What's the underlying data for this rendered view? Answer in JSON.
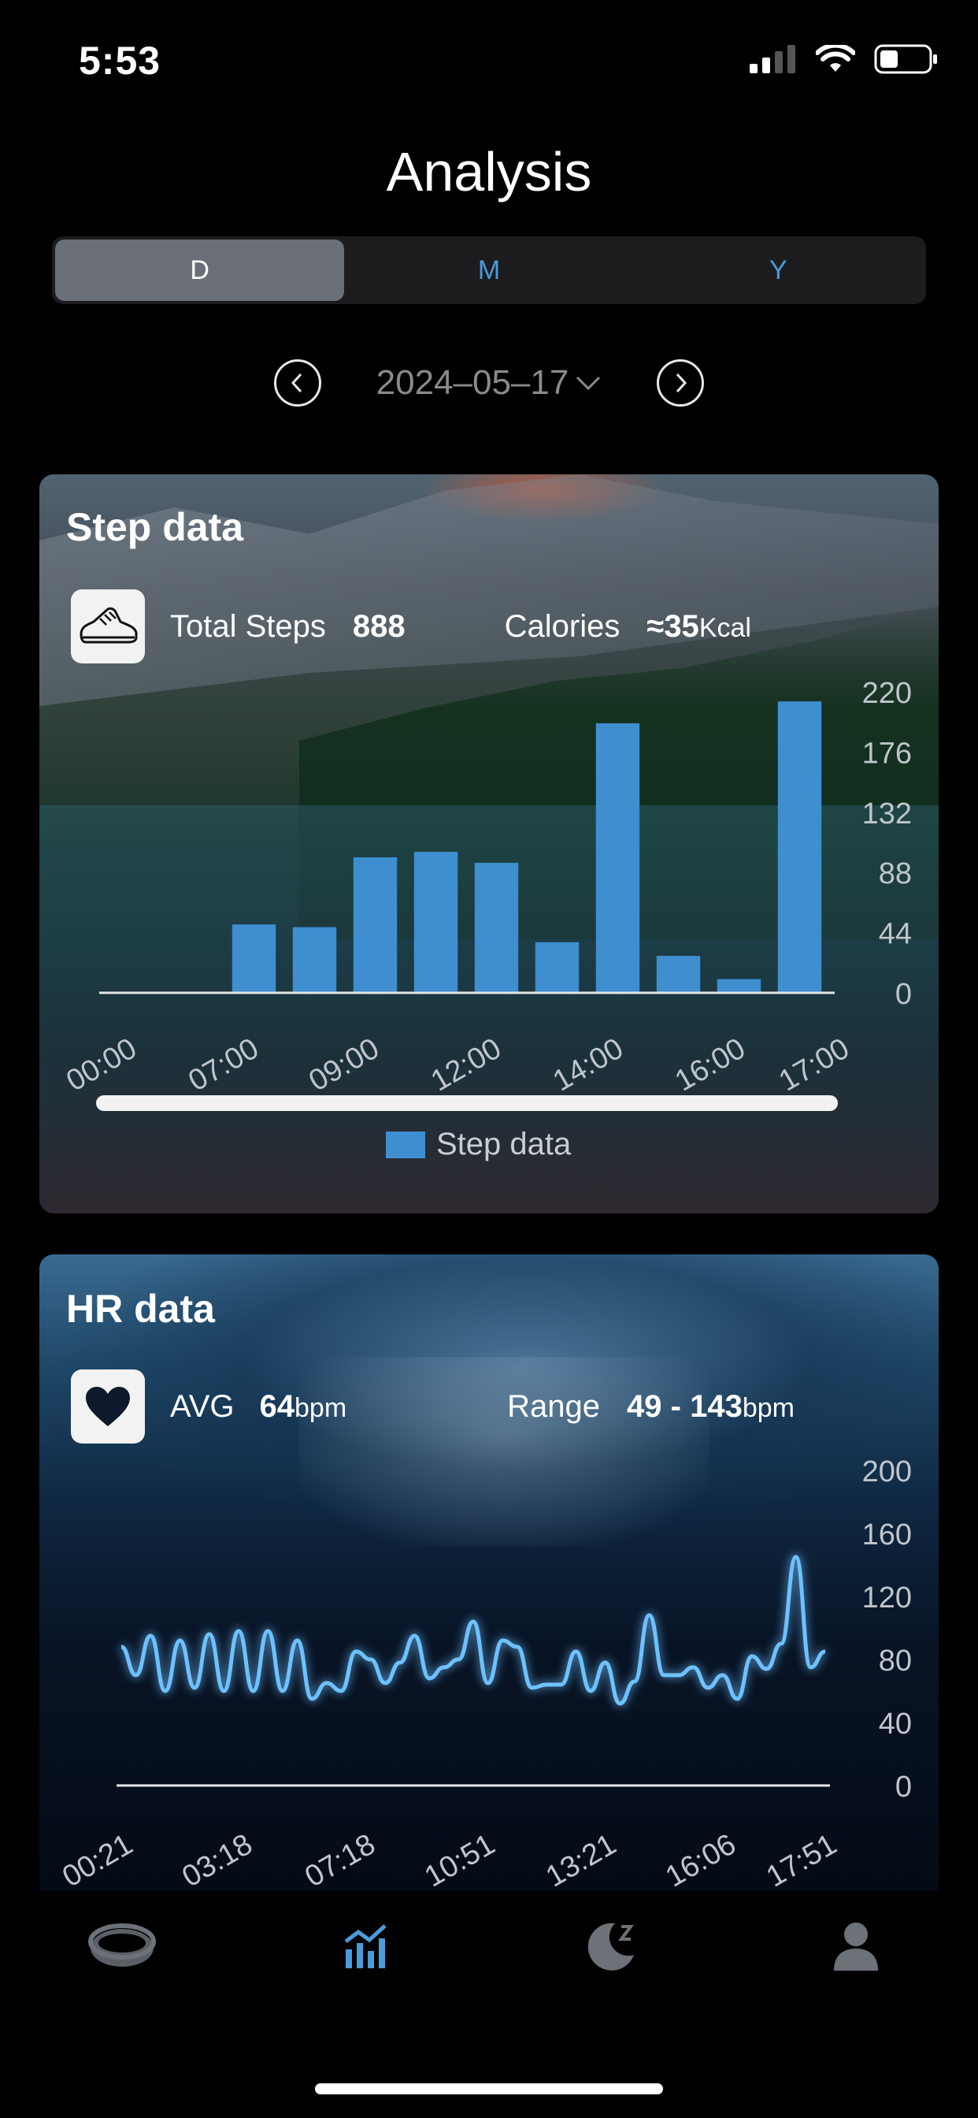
{
  "status_bar": {
    "time": "5:53"
  },
  "header": {
    "title": "Analysis"
  },
  "segmented": {
    "options": [
      "D",
      "M",
      "Y"
    ],
    "selected": "D"
  },
  "date_nav": {
    "date": "2024–05–17"
  },
  "step_card": {
    "title": "Step data",
    "total_label": "Total Steps",
    "total_value": "888",
    "calories_label": "Calories",
    "calories_value": "≈35",
    "calories_unit": "Kcal",
    "legend": "Step data"
  },
  "hr_card": {
    "title": "HR data",
    "avg_label": "AVG",
    "avg_value": "64",
    "avg_unit": "bpm",
    "range_label": "Range",
    "range_value": "49 - 143",
    "range_unit": "bpm"
  },
  "tabs": [
    {
      "name": "ring",
      "icon": "ring-icon"
    },
    {
      "name": "analysis",
      "icon": "chart-icon",
      "active": true
    },
    {
      "name": "sleep",
      "icon": "moon-icon"
    },
    {
      "name": "profile",
      "icon": "person-icon"
    }
  ],
  "colors": {
    "accent": "#4a9bdc",
    "bar": "#3e8ed0",
    "hr_line": "#6ec1ff"
  },
  "chart_data": [
    {
      "type": "bar",
      "title": "Step data",
      "y_ticks": [
        220,
        176,
        132,
        88,
        44,
        0
      ],
      "ylim": [
        0,
        220
      ],
      "x_ticks": [
        "00:00",
        "07:00",
        "09:00",
        "12:00",
        "14:00",
        "16:00",
        "17:00"
      ],
      "series": [
        {
          "name": "Step data",
          "values": [
            0,
            0,
            50,
            48,
            99,
            103,
            95,
            37,
            197,
            27,
            10,
            213
          ]
        }
      ],
      "legend_position": "bottom"
    },
    {
      "type": "line",
      "title": "HR data",
      "y_ticks": [
        200,
        160,
        120,
        80,
        40,
        0
      ],
      "ylim": [
        0,
        200
      ],
      "x_ticks": [
        "00:21",
        "03:18",
        "07:18",
        "10:51",
        "13:21",
        "16:06",
        "17:51"
      ],
      "series": [
        {
          "values": [
            88,
            70,
            95,
            60,
            92,
            62,
            96,
            60,
            98,
            60,
            98,
            60,
            92,
            55,
            65,
            60,
            85,
            80,
            65,
            78,
            95,
            68,
            75,
            80,
            104,
            65,
            92,
            88,
            62,
            64,
            64,
            85,
            60,
            78,
            52,
            66,
            108,
            70,
            70,
            75,
            62,
            70,
            55,
            82,
            74,
            90,
            145,
            75,
            85
          ]
        }
      ]
    }
  ]
}
